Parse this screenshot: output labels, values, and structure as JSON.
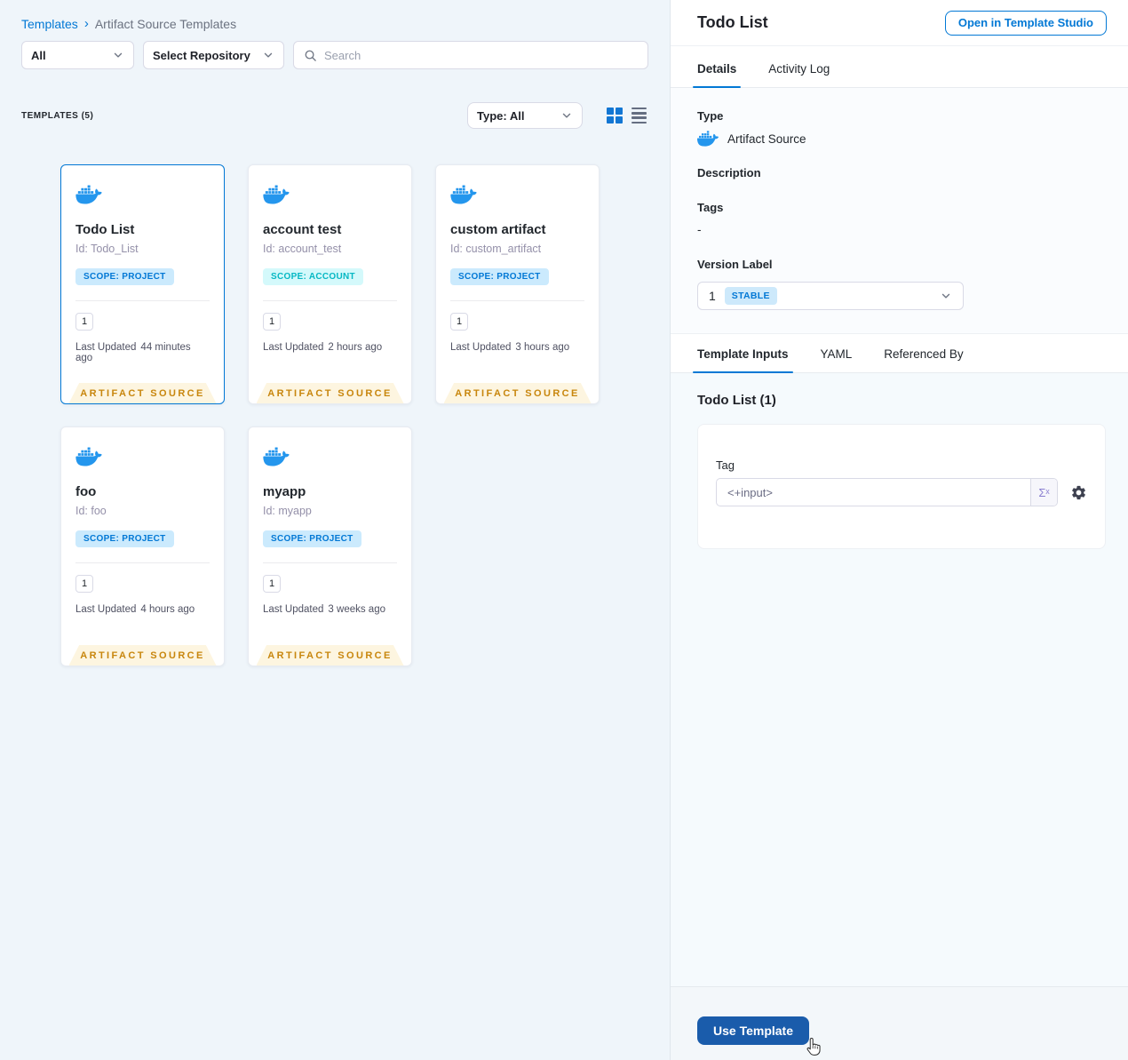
{
  "colors": {
    "accent_blue": "#0278d5",
    "primary_button_blue": "#1a5cab",
    "docker_blue": "#2496ED",
    "ribbon_text": "#c8860d",
    "ribbon_bg": "#fdf5e0",
    "scope_project_text": "#0278d5",
    "scope_project_bg": "#cbeafd",
    "scope_account_text": "#06b8c4",
    "scope_account_bg": "#d4f9fb",
    "left_background": "#eff5fa"
  },
  "breadcrumb": {
    "root": "Templates",
    "separator": "›",
    "current": "Artifact Source Templates"
  },
  "filters": {
    "scope": "All",
    "repository": "Select Repository",
    "search_placeholder": "Search"
  },
  "toolbar": {
    "count": "TEMPLATES (5)",
    "type_filter": "Type: All"
  },
  "labels": {
    "last_updated": "Last Updated",
    "ribbon": "ARTIFACT SOURCE"
  },
  "cards": [
    {
      "title": "Todo List",
      "id": "Id: Todo_List",
      "scope": "SCOPE: PROJECT",
      "version": "1",
      "last_updated": "44 minutes ago"
    },
    {
      "title": "account test",
      "id": "Id: account_test",
      "scope": "SCOPE: ACCOUNT",
      "version": "1",
      "last_updated": "2 hours ago"
    },
    {
      "title": "custom artifact",
      "id": "Id: custom_artifact",
      "scope": "SCOPE: PROJECT",
      "version": "1",
      "last_updated": "3 hours ago"
    },
    {
      "title": "foo",
      "id": "Id: foo",
      "scope": "SCOPE: PROJECT",
      "version": "1",
      "last_updated": "4 hours ago"
    },
    {
      "title": "myapp",
      "id": "Id: myapp",
      "scope": "SCOPE: PROJECT",
      "version": "1",
      "last_updated": "3 weeks ago"
    }
  ],
  "panel": {
    "title": "Todo List",
    "open_button": "Open in Template Studio",
    "tabs": {
      "details": "Details",
      "activity_log": "Activity Log"
    },
    "type_label": "Type",
    "type_value": "Artifact Source",
    "description_label": "Description",
    "tags_label": "Tags",
    "tags_value": "-",
    "version_label": "Version Label",
    "version_value": "1",
    "version_badge": "STABLE",
    "input_tabs": {
      "template_inputs": "Template Inputs",
      "yaml": "YAML",
      "referenced_by": "Referenced By"
    },
    "inputs_heading": "Todo List (1)",
    "tag_label": "Tag",
    "tag_value": "<+input>",
    "expression_symbol": "Σˣ",
    "use_template_button": "Use Template"
  }
}
